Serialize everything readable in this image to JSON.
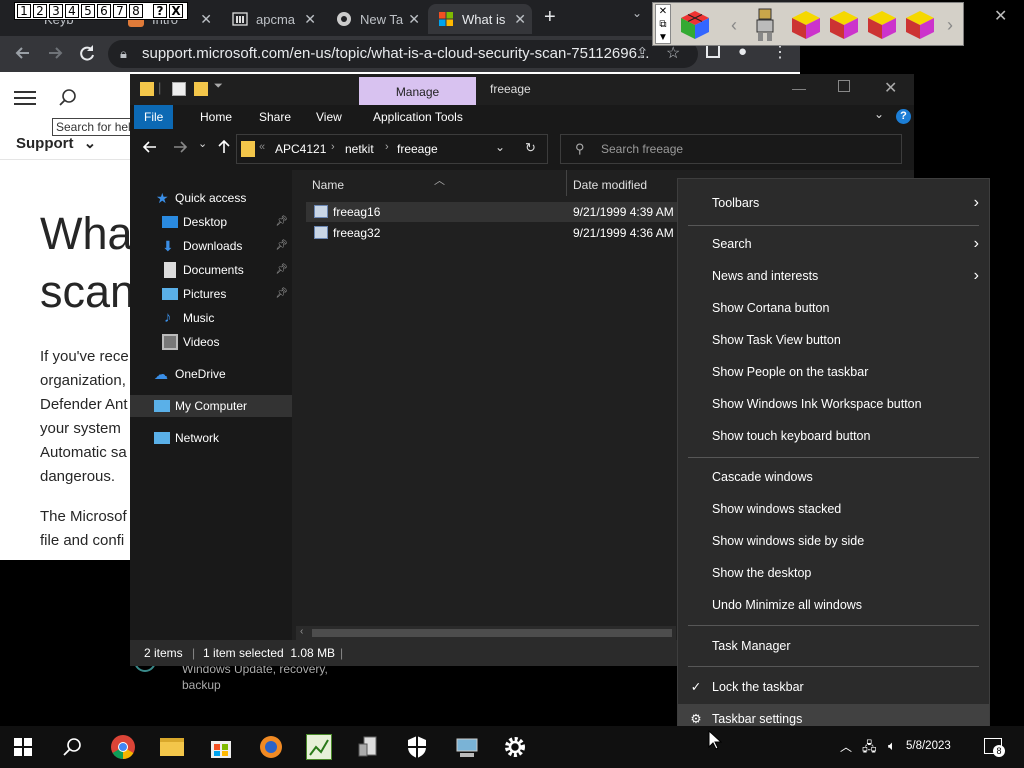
{
  "numbox": [
    "1",
    "2",
    "3",
    "4",
    "5",
    "6",
    "7",
    "8",
    "?",
    "X"
  ],
  "browser": {
    "tabs": [
      {
        "label": "Keyb",
        "icon": "tab-icon"
      },
      {
        "label": "Intro",
        "icon": "tab-icon"
      },
      {
        "label": "apcma",
        "icon": "bank-icon"
      },
      {
        "label": "New Ta",
        "icon": "chrome-icon"
      },
      {
        "label": "What is",
        "icon": "windows-logo-icon"
      }
    ],
    "new_tab": "+",
    "url": "support.microsoft.com/en-us/topic/what-is-a-cloud-security-scan-75112696...",
    "support_label": "Support",
    "search_placeholder": "Search for hel",
    "article": {
      "title_line1": "What",
      "title_line2": "scan",
      "paragraph1": [
        "If you've rece",
        "organization,",
        "Defender Ant",
        "your system",
        "Automatic sa",
        "dangerous."
      ],
      "paragraph2": [
        "The Microsof",
        "file and confi"
      ]
    }
  },
  "explorer": {
    "title": "freeage",
    "manage_label": "Manage",
    "ribbon_tabs": [
      "File",
      "Home",
      "Share",
      "View",
      "Application Tools"
    ],
    "breadcrumb": [
      "APC4121",
      "netkit",
      "freeage"
    ],
    "search_placeholder": "Search freeage",
    "nav": [
      {
        "label": "Quick access",
        "pinned": false
      },
      {
        "label": "Desktop",
        "pinned": true
      },
      {
        "label": "Downloads",
        "pinned": true
      },
      {
        "label": "Documents",
        "pinned": true
      },
      {
        "label": "Pictures",
        "pinned": true
      },
      {
        "label": "Music",
        "pinned": false
      },
      {
        "label": "Videos",
        "pinned": false
      },
      {
        "label": "OneDrive",
        "pinned": false
      },
      {
        "label": "My Computer",
        "pinned": false
      },
      {
        "label": "Network",
        "pinned": false
      }
    ],
    "columns": [
      "Name",
      "Date modified"
    ],
    "files": [
      {
        "name": "freeag16",
        "date": "9/21/1999 4:39 AM"
      },
      {
        "name": "freeag32",
        "date": "9/21/1999 4:36 AM"
      }
    ],
    "status": {
      "items": "2 items",
      "selected": "1 item selected  1.08 MB"
    }
  },
  "settings_under": {
    "line1": "Windows Update, recovery,",
    "line2": "backup"
  },
  "context_menu": {
    "items": [
      {
        "label": "Toolbars",
        "submenu": true
      },
      {
        "label": "Search",
        "submenu": true
      },
      {
        "label": "News and interests",
        "submenu": true
      },
      {
        "label": "Show Cortana button"
      },
      {
        "label": "Show Task View button"
      },
      {
        "label": "Show People on the taskbar"
      },
      {
        "label": "Show Windows Ink Workspace button"
      },
      {
        "label": "Show touch keyboard button"
      },
      {
        "label": "Cascade windows"
      },
      {
        "label": "Show windows stacked"
      },
      {
        "label": "Show windows side by side"
      },
      {
        "label": "Show the desktop"
      },
      {
        "label": "Undo Minimize all windows"
      },
      {
        "label": "Task Manager"
      },
      {
        "label": "Lock the taskbar",
        "checked": true
      },
      {
        "label": "Taskbar settings",
        "icon": "gear-icon"
      }
    ]
  },
  "taskbar": {
    "date": "5/8/2023",
    "notification_count": "8"
  }
}
